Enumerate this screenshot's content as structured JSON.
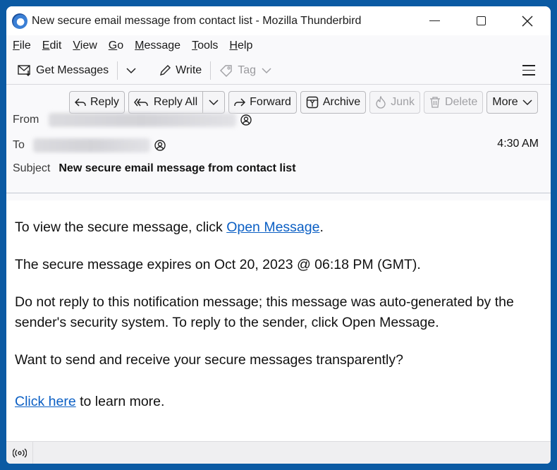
{
  "window": {
    "title": "New secure email message from contact list - Mozilla Thunderbird",
    "controls": [
      "minimize",
      "maximize",
      "close"
    ]
  },
  "menubar": {
    "items": [
      {
        "accel": "F",
        "rest": "ile"
      },
      {
        "accel": "E",
        "rest": "dit"
      },
      {
        "accel": "V",
        "rest": "iew"
      },
      {
        "accel": "G",
        "rest": "o"
      },
      {
        "accel": "M",
        "rest": "essage"
      },
      {
        "accel": "T",
        "rest": "ools"
      },
      {
        "accel": "H",
        "rest": "elp"
      }
    ]
  },
  "toolbar": {
    "get_messages": "Get Messages",
    "write": "Write",
    "tag": "Tag"
  },
  "actions": {
    "reply": "Reply",
    "reply_all": "Reply All",
    "forward": "Forward",
    "archive": "Archive",
    "junk": "Junk",
    "delete": "Delete",
    "more": "More"
  },
  "header": {
    "from_label": "From",
    "to_label": "To",
    "subject_label": "Subject",
    "subject": "New secure email message from contact list",
    "time": "4:30 AM"
  },
  "message": {
    "p1_prefix": "To view the secure message, click ",
    "p1_link": "Open Message",
    "p1_suffix": ".",
    "p2": "The secure message expires on Oct 20, 2023 @ 06:18 PM (GMT).",
    "p3": "Do not reply to this notification message; this message was auto-generated by the sender's security system. To reply to the sender, click Open Message.",
    "p4": "Want to send and receive your secure messages transparently?",
    "p5_link": "Click here",
    "p5_suffix": " to learn more."
  },
  "colors": {
    "accent": "#0b5aa3",
    "link": "#0b5fc4"
  }
}
